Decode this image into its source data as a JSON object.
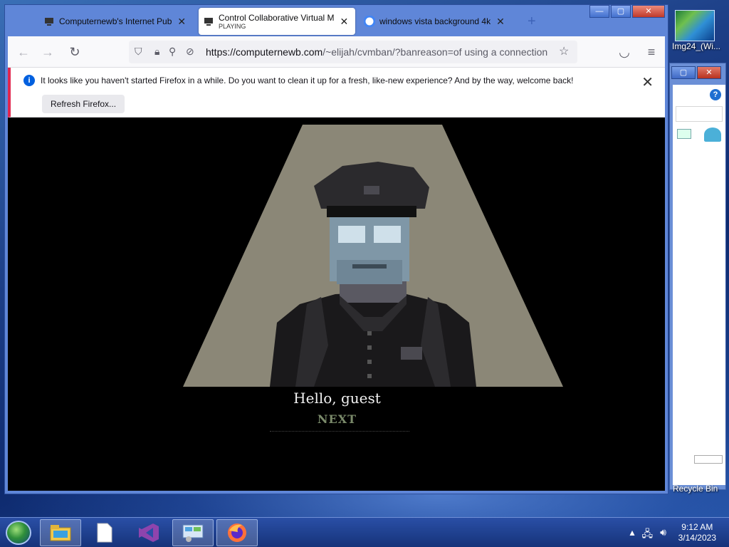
{
  "desktop": {
    "icon_label": "Img24_(Wi...",
    "recycle_label": "Recycle Bin"
  },
  "browser": {
    "tabs": [
      {
        "title": "Computernewb's Internet Pub",
        "state": "inactive"
      },
      {
        "title": "Control Collaborative Virtual M",
        "subtitle": "PLAYING",
        "state": "active"
      },
      {
        "title": "windows vista background 4k",
        "state": "inactive"
      }
    ],
    "url_host": "https://computernewb.com",
    "url_path": "/~elijah/cvmban/?banreason=of using a connection",
    "notification": {
      "message": "It looks like you haven't started Firefox in a while. Do you want to clean it up for a fresh, like-new experience? And by the way, welcome back!",
      "button": "Refresh Firefox..."
    }
  },
  "game": {
    "greeting": "Hello, guest",
    "next_label": "NEXT"
  },
  "taskbar": {
    "time": "9:12 AM",
    "date": "3/14/2023"
  },
  "colors": {
    "accent": "#0060df",
    "warning_bar": "#e22850",
    "spotlight": "#8b8777"
  },
  "icons": [
    "start-orb-icon",
    "file-explorer-icon",
    "blank-file-icon",
    "visual-studio-icon",
    "control-panel-icon",
    "firefox-icon"
  ]
}
